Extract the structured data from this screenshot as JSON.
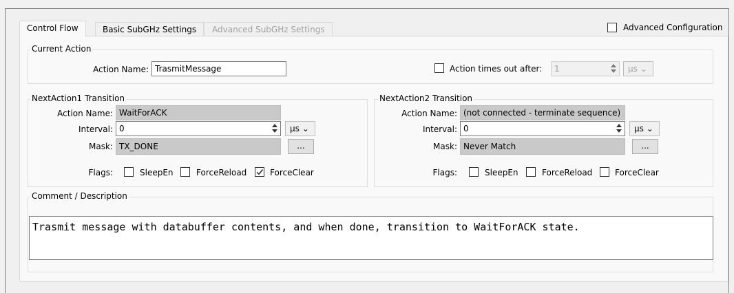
{
  "tabs": [
    {
      "label": "Control Flow",
      "state": "active"
    },
    {
      "label": "Basic SubGHz Settings",
      "state": "normal"
    },
    {
      "label": "Advanced SubGHz Settings",
      "state": "disabled"
    }
  ],
  "advanced_configuration": {
    "label": "Advanced Configuration",
    "checked": false
  },
  "current_action": {
    "group_title": "Current Action",
    "action_name_label": "Action Name:",
    "action_name_value": "TrasmitMessage",
    "timeout_label": "Action times out after:",
    "timeout_checked": false,
    "timeout_value": "1",
    "timeout_unit": "µs"
  },
  "next_action_1": {
    "group_title": "NextAction1 Transition",
    "action_name_label": "Action Name:",
    "action_name_value": "WaitForACK",
    "interval_label": "Interval:",
    "interval_value": "0",
    "interval_unit": "µs",
    "mask_label": "Mask:",
    "mask_value": "TX_DONE",
    "mask_button": "...",
    "flags_label": "Flags:",
    "flags": [
      {
        "label": "SleepEn",
        "checked": false
      },
      {
        "label": "ForceReload",
        "checked": false
      },
      {
        "label": "ForceClear",
        "checked": true
      }
    ]
  },
  "next_action_2": {
    "group_title": "NextAction2 Transition",
    "action_name_label": "Action Name:",
    "action_name_value": "(not connected - terminate sequence)",
    "interval_label": "Interval:",
    "interval_value": "0",
    "interval_unit": "µs",
    "mask_label": "Mask:",
    "mask_value": "Never Match",
    "mask_button": "...",
    "flags_label": "Flags:",
    "flags": [
      {
        "label": "SleepEn",
        "checked": false
      },
      {
        "label": "ForceReload",
        "checked": false
      },
      {
        "label": "ForceClear",
        "checked": false
      }
    ]
  },
  "comment": {
    "group_title": "Comment / Description",
    "text": "Trasmit message with databuffer contents, and when done, transition to WaitForACK state."
  },
  "icons": {
    "checkmark": "checkmark-icon",
    "spin_up": "spin-up-icon",
    "spin_down": "spin-down-icon",
    "dropdown": "chevron-down-icon"
  }
}
